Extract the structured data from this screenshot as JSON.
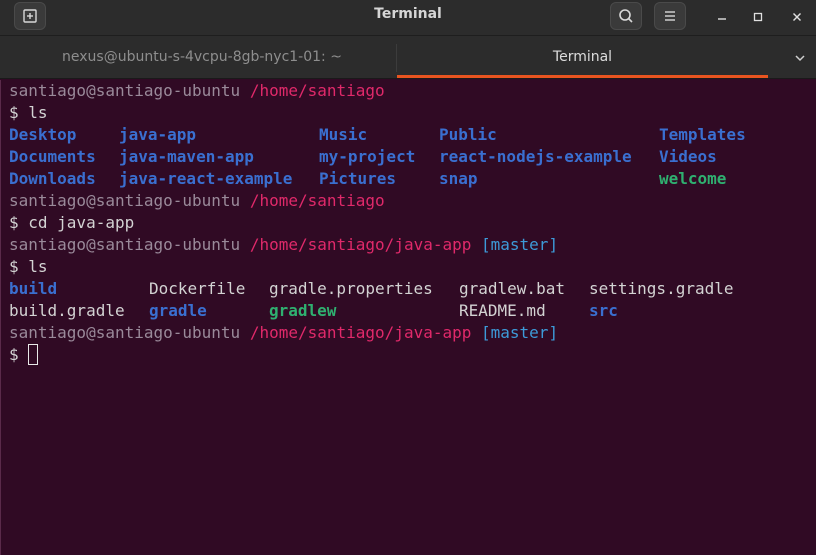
{
  "window": {
    "title": "Terminal",
    "icons": {
      "new_tab": "new-tab-icon",
      "search": "search-icon",
      "menu": "hamburger-menu-icon",
      "minimize": "minimize-icon",
      "maximize": "maximize-icon",
      "close": "close-icon"
    }
  },
  "tabs": [
    {
      "label": "nexus@ubuntu-s-4vcpu-8gb-nyc1-01: ~",
      "active": false
    },
    {
      "label": "Terminal",
      "active": true
    }
  ],
  "terminal": {
    "user_host": "santiago@santiago-ubuntu",
    "prompt_symbol": "$",
    "lines": [
      {
        "type": "prompt",
        "path": "/home/santiago"
      },
      {
        "type": "command",
        "text": "ls"
      },
      {
        "type": "listing",
        "entries": [
          {
            "name": "Desktop",
            "kind": "dir"
          },
          {
            "name": "java-app",
            "kind": "dir"
          },
          {
            "name": "Music",
            "kind": "dir"
          },
          {
            "name": "Public",
            "kind": "dir"
          },
          {
            "name": "Templates",
            "kind": "dir"
          }
        ]
      },
      {
        "type": "listing",
        "entries": [
          {
            "name": "Documents",
            "kind": "dir"
          },
          {
            "name": "java-maven-app",
            "kind": "dir"
          },
          {
            "name": "my-project",
            "kind": "dir"
          },
          {
            "name": "react-nodejs-example",
            "kind": "dir"
          },
          {
            "name": "Videos",
            "kind": "dir"
          }
        ]
      },
      {
        "type": "listing",
        "entries": [
          {
            "name": "Downloads",
            "kind": "dir"
          },
          {
            "name": "java-react-example",
            "kind": "dir"
          },
          {
            "name": "Pictures",
            "kind": "dir"
          },
          {
            "name": "snap",
            "kind": "dir"
          },
          {
            "name": "welcome",
            "kind": "exe"
          }
        ]
      },
      {
        "type": "prompt",
        "path": "/home/santiago"
      },
      {
        "type": "command",
        "text": "cd java-app"
      },
      {
        "type": "prompt",
        "path": "/home/santiago/java-app",
        "branch": "[master]"
      },
      {
        "type": "command",
        "text": "ls"
      },
      {
        "type": "listing2",
        "entries": [
          {
            "name": "build",
            "kind": "dir"
          },
          {
            "name": "Dockerfile",
            "kind": "file"
          },
          {
            "name": "gradle.properties",
            "kind": "file"
          },
          {
            "name": "gradlew.bat",
            "kind": "file"
          },
          {
            "name": "settings.gradle",
            "kind": "file"
          }
        ]
      },
      {
        "type": "listing2",
        "entries": [
          {
            "name": "build.gradle",
            "kind": "file"
          },
          {
            "name": "gradle",
            "kind": "dir"
          },
          {
            "name": "gradlew",
            "kind": "exe"
          },
          {
            "name": "README.md",
            "kind": "file"
          },
          {
            "name": "src",
            "kind": "dir"
          }
        ]
      },
      {
        "type": "prompt",
        "path": "/home/santiago/java-app",
        "branch": "[master]"
      },
      {
        "type": "input",
        "text": ""
      }
    ]
  }
}
